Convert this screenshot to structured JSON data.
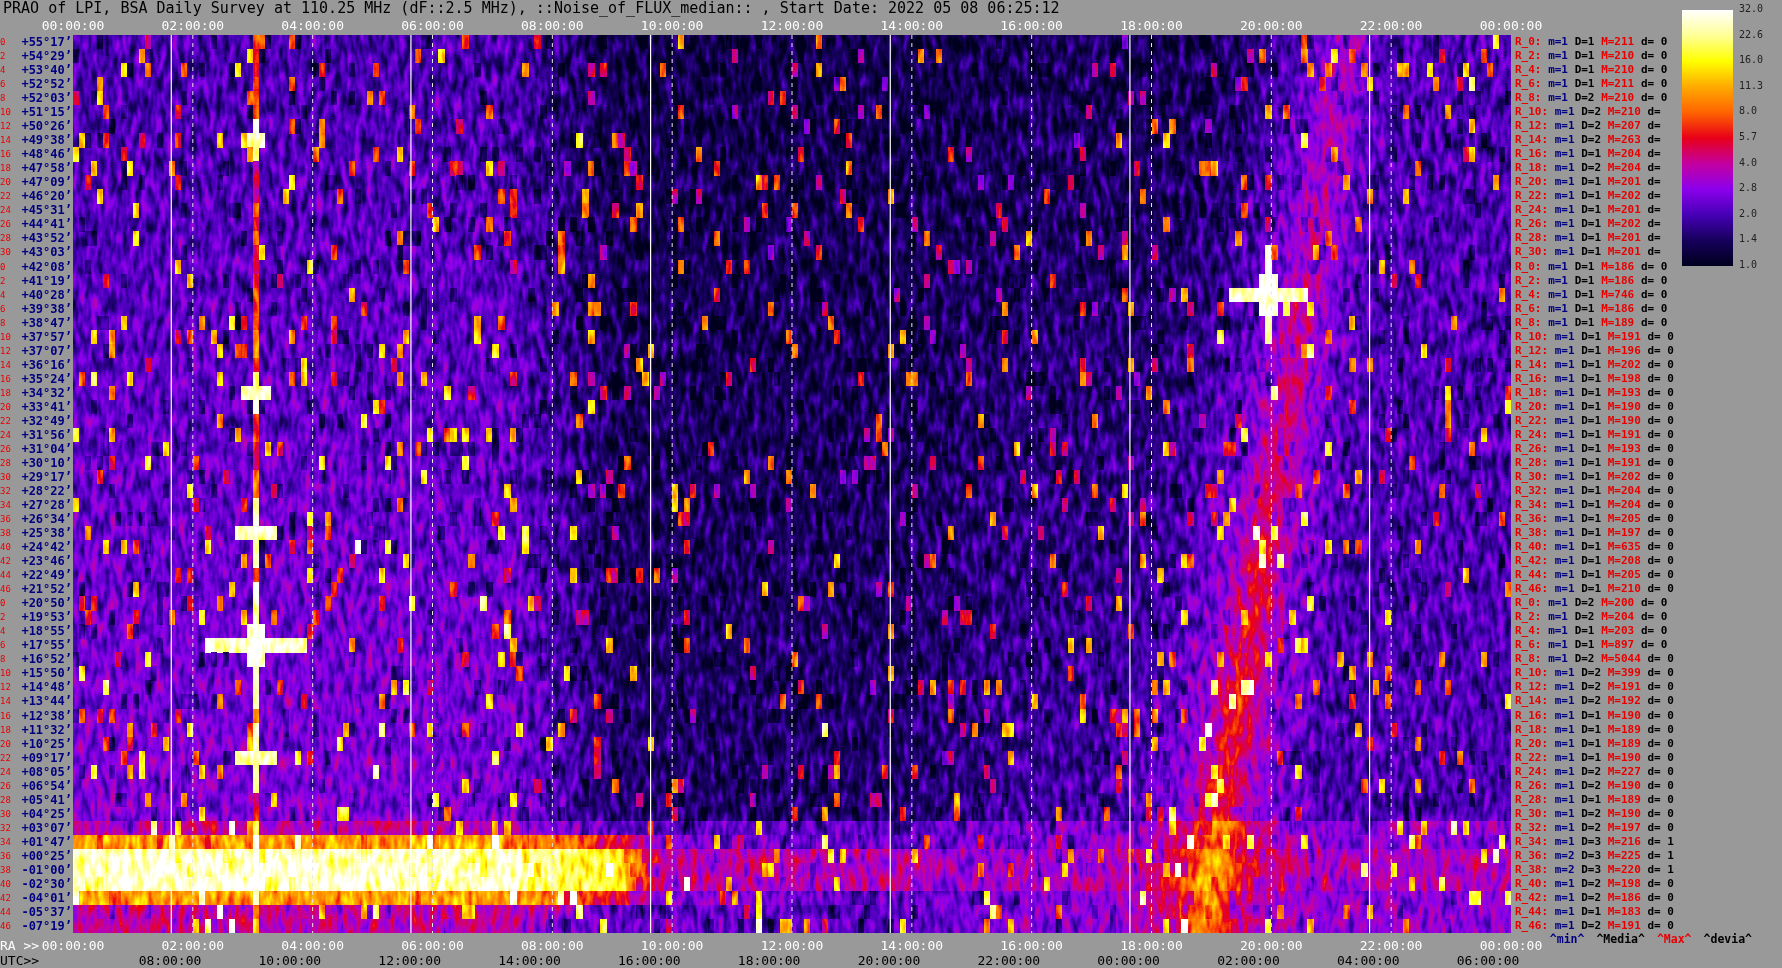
{
  "title": "PRAO of LPI, BSA Daily Survey at 110.25 MHz (dF::2.5 MHz), ::Noise_of_FLUX_median:: , Start Date: 2022 05 08 06:25:12",
  "top_axis": {
    "labels": [
      "00:00:00",
      "02:00:00",
      "04:00:00",
      "06:00:00",
      "08:00:00",
      "10:00:00",
      "12:00:00",
      "14:00:00",
      "16:00:00",
      "18:00:00",
      "20:00:00",
      "22:00:00",
      "00:00:00"
    ]
  },
  "rows": [
    {
      "index": "0",
      "declination": "+55°17’",
      "receiver": "R_0:",
      "min": "m=1",
      "median": "D=1",
      "max": "M=211",
      "deviation": "d= 0"
    },
    {
      "index": "2",
      "declination": "+54°29’",
      "receiver": "R_2:",
      "min": "m=1",
      "median": "D=1",
      "max": "M=210",
      "deviation": "d= 0"
    },
    {
      "index": "4",
      "declination": "+53°40’",
      "receiver": "R_4:",
      "min": "m=1",
      "median": "D=1",
      "max": "M=210",
      "deviation": "d= 0"
    },
    {
      "index": "6",
      "declination": "+52°52’",
      "receiver": "R_6:",
      "min": "m=1",
      "median": "D=1",
      "max": "M=211",
      "deviation": "d= 0"
    },
    {
      "index": "8",
      "declination": "+52°03’",
      "receiver": "R_8:",
      "min": "m=1",
      "median": "D=2",
      "max": "M=210",
      "deviation": "d= 0"
    },
    {
      "index": "10",
      "declination": "+51°15’",
      "receiver": "R_10:",
      "min": "m=1",
      "median": "D=2",
      "max": "M=210",
      "deviation": "d="
    },
    {
      "index": "12",
      "declination": "+50°26’",
      "receiver": "R_12:",
      "min": "m=1",
      "median": "D=2",
      "max": "M=207",
      "deviation": "d="
    },
    {
      "index": "14",
      "declination": "+49°38’",
      "receiver": "R_14:",
      "min": "m=1",
      "median": "D=2",
      "max": "M=263",
      "deviation": "d="
    },
    {
      "index": "16",
      "declination": "+48°46’",
      "receiver": "R_16:",
      "min": "m=1",
      "median": "D=1",
      "max": "M=204",
      "deviation": "d="
    },
    {
      "index": "18",
      "declination": "+47°58’",
      "receiver": "R_18:",
      "min": "m=1",
      "median": "D=2",
      "max": "M=204",
      "deviation": "d="
    },
    {
      "index": "20",
      "declination": "+47°09’",
      "receiver": "R_20:",
      "min": "m=1",
      "median": "D=1",
      "max": "M=201",
      "deviation": "d="
    },
    {
      "index": "22",
      "declination": "+46°20’",
      "receiver": "R_22:",
      "min": "m=1",
      "median": "D=1",
      "max": "M=202",
      "deviation": "d="
    },
    {
      "index": "24",
      "declination": "+45°31’",
      "receiver": "R_24:",
      "min": "m=1",
      "median": "D=1",
      "max": "M=201",
      "deviation": "d="
    },
    {
      "index": "26",
      "declination": "+44°41’",
      "receiver": "R_26:",
      "min": "m=1",
      "median": "D=1",
      "max": "M=202",
      "deviation": "d="
    },
    {
      "index": "28",
      "declination": "+43°52’",
      "receiver": "R_28:",
      "min": "m=1",
      "median": "D=1",
      "max": "M=201",
      "deviation": "d="
    },
    {
      "index": "30",
      "declination": "+43°03’",
      "receiver": "R_30:",
      "min": "m=1",
      "median": "D=1",
      "max": "M=201",
      "deviation": "d="
    },
    {
      "index": "0",
      "declination": "+42°08’",
      "receiver": "R_0:",
      "min": "m=1",
      "median": "D=1",
      "max": "M=186",
      "deviation": "d= 0"
    },
    {
      "index": "2",
      "declination": "+41°19’",
      "receiver": "R_2:",
      "min": "m=1",
      "median": "D=1",
      "max": "M=186",
      "deviation": "d= 0"
    },
    {
      "index": "4",
      "declination": "+40°28’",
      "receiver": "R_4:",
      "min": "m=1",
      "median": "D=1",
      "max": "M=746",
      "deviation": "d= 0"
    },
    {
      "index": "6",
      "declination": "+39°38’",
      "receiver": "R_6:",
      "min": "m=1",
      "median": "D=1",
      "max": "M=186",
      "deviation": "d= 0"
    },
    {
      "index": "8",
      "declination": "+38°47’",
      "receiver": "R_8:",
      "min": "m=1",
      "median": "D=1",
      "max": "M=189",
      "deviation": "d= 0"
    },
    {
      "index": "10",
      "declination": "+37°57’",
      "receiver": "R_10:",
      "min": "m=1",
      "median": "D=1",
      "max": "M=191",
      "deviation": "d= 0"
    },
    {
      "index": "12",
      "declination": "+37°07’",
      "receiver": "R_12:",
      "min": "m=1",
      "median": "D=1",
      "max": "M=196",
      "deviation": "d= 0"
    },
    {
      "index": "14",
      "declination": "+36°16’",
      "receiver": "R_14:",
      "min": "m=1",
      "median": "D=1",
      "max": "M=202",
      "deviation": "d= 0"
    },
    {
      "index": "16",
      "declination": "+35°24’",
      "receiver": "R_16:",
      "min": "m=1",
      "median": "D=1",
      "max": "M=198",
      "deviation": "d= 0"
    },
    {
      "index": "18",
      "declination": "+34°32’",
      "receiver": "R_18:",
      "min": "m=1",
      "median": "D=1",
      "max": "M=193",
      "deviation": "d= 0"
    },
    {
      "index": "20",
      "declination": "+33°41’",
      "receiver": "R_20:",
      "min": "m=1",
      "median": "D=1",
      "max": "M=190",
      "deviation": "d= 0"
    },
    {
      "index": "22",
      "declination": "+32°49’",
      "receiver": "R_22:",
      "min": "m=1",
      "median": "D=1",
      "max": "M=190",
      "deviation": "d= 0"
    },
    {
      "index": "24",
      "declination": "+31°56’",
      "receiver": "R_24:",
      "min": "m=1",
      "median": "D=1",
      "max": "M=191",
      "deviation": "d= 0"
    },
    {
      "index": "26",
      "declination": "+31°04’",
      "receiver": "R_26:",
      "min": "m=1",
      "median": "D=1",
      "max": "M=193",
      "deviation": "d= 0"
    },
    {
      "index": "28",
      "declination": "+30°10’",
      "receiver": "R_28:",
      "min": "m=1",
      "median": "D=1",
      "max": "M=191",
      "deviation": "d= 0"
    },
    {
      "index": "30",
      "declination": "+29°17’",
      "receiver": "R_30:",
      "min": "m=1",
      "median": "D=1",
      "max": "M=202",
      "deviation": "d= 0"
    },
    {
      "index": "32",
      "declination": "+28°22’",
      "receiver": "R_32:",
      "min": "m=1",
      "median": "D=1",
      "max": "M=204",
      "deviation": "d= 0"
    },
    {
      "index": "34",
      "declination": "+27°28’",
      "receiver": "R_34:",
      "min": "m=1",
      "median": "D=1",
      "max": "M=204",
      "deviation": "d= 0"
    },
    {
      "index": "36",
      "declination": "+26°34’",
      "receiver": "R_36:",
      "min": "m=1",
      "median": "D=1",
      "max": "M=205",
      "deviation": "d= 0"
    },
    {
      "index": "38",
      "declination": "+25°38’",
      "receiver": "R_38:",
      "min": "m=1",
      "median": "D=1",
      "max": "M=197",
      "deviation": "d= 0"
    },
    {
      "index": "40",
      "declination": "+24°42’",
      "receiver": "R_40:",
      "min": "m=1",
      "median": "D=1",
      "max": "M=635",
      "deviation": "d= 0"
    },
    {
      "index": "42",
      "declination": "+23°46’",
      "receiver": "R_42:",
      "min": "m=1",
      "median": "D=1",
      "max": "M=208",
      "deviation": "d= 0"
    },
    {
      "index": "44",
      "declination": "+22°49’",
      "receiver": "R_44:",
      "min": "m=1",
      "median": "D=1",
      "max": "M=205",
      "deviation": "d= 0"
    },
    {
      "index": "46",
      "declination": "+21°52’",
      "receiver": "R_46:",
      "min": "m=1",
      "median": "D=1",
      "max": "M=210",
      "deviation": "d= 0"
    },
    {
      "index": "0",
      "declination": "+20°50’",
      "receiver": "R_0:",
      "min": "m=1",
      "median": "D=2",
      "max": "M=200",
      "deviation": "d= 0"
    },
    {
      "index": "2",
      "declination": "+19°53’",
      "receiver": "R_2:",
      "min": "m=1",
      "median": "D=2",
      "max": "M=204",
      "deviation": "d= 0"
    },
    {
      "index": "4",
      "declination": "+18°55’",
      "receiver": "R_4:",
      "min": "m=1",
      "median": "D=1",
      "max": "M=203",
      "deviation": "d= 0"
    },
    {
      "index": "6",
      "declination": "+17°55’",
      "receiver": "R_6:",
      "min": "m=1",
      "median": "D=1",
      "max": "M=897",
      "deviation": "d= 0"
    },
    {
      "index": "8",
      "declination": "+16°52’",
      "receiver": "R_8:",
      "min": "m=1",
      "median": "D=2",
      "max": "M=5044",
      "deviation": "d= 0"
    },
    {
      "index": "10",
      "declination": "+15°50’",
      "receiver": "R_10:",
      "min": "m=1",
      "median": "D=2",
      "max": "M=399",
      "deviation": "d= 0"
    },
    {
      "index": "12",
      "declination": "+14°48’",
      "receiver": "R_12:",
      "min": "m=1",
      "median": "D=2",
      "max": "M=191",
      "deviation": "d= 0"
    },
    {
      "index": "14",
      "declination": "+13°44’",
      "receiver": "R_14:",
      "min": "m=1",
      "median": "D=2",
      "max": "M=192",
      "deviation": "d= 0"
    },
    {
      "index": "16",
      "declination": "+12°38’",
      "receiver": "R_16:",
      "min": "m=1",
      "median": "D=1",
      "max": "M=190",
      "deviation": "d= 0"
    },
    {
      "index": "18",
      "declination": "+11°32’",
      "receiver": "R_18:",
      "min": "m=1",
      "median": "D=1",
      "max": "M=189",
      "deviation": "d= 0"
    },
    {
      "index": "20",
      "declination": "+10°25’",
      "receiver": "R_20:",
      "min": "m=1",
      "median": "D=1",
      "max": "M=189",
      "deviation": "d= 0"
    },
    {
      "index": "22",
      "declination": "+09°17’",
      "receiver": "R_22:",
      "min": "m=1",
      "median": "D=1",
      "max": "M=190",
      "deviation": "d= 0"
    },
    {
      "index": "24",
      "declination": "+08°05’",
      "receiver": "R_24:",
      "min": "m=1",
      "median": "D=2",
      "max": "M=227",
      "deviation": "d= 0"
    },
    {
      "index": "26",
      "declination": "+06°54’",
      "receiver": "R_26:",
      "min": "m=1",
      "median": "D=2",
      "max": "M=190",
      "deviation": "d= 0"
    },
    {
      "index": "28",
      "declination": "+05°41’",
      "receiver": "R_28:",
      "min": "m=1",
      "median": "D=1",
      "max": "M=189",
      "deviation": "d= 0"
    },
    {
      "index": "30",
      "declination": "+04°25’",
      "receiver": "R_30:",
      "min": "m=1",
      "median": "D=2",
      "max": "M=190",
      "deviation": "d= 0"
    },
    {
      "index": "32",
      "declination": "+03°07’",
      "receiver": "R_32:",
      "min": "m=1",
      "median": "D=2",
      "max": "M=197",
      "deviation": "d= 0"
    },
    {
      "index": "34",
      "declination": "+01°47’",
      "receiver": "R_34:",
      "min": "m=1",
      "median": "D=3",
      "max": "M=216",
      "deviation": "d= 1"
    },
    {
      "index": "36",
      "declination": "+00°25’",
      "receiver": "R_36:",
      "min": "m=2",
      "median": "D=3",
      "max": "M=225",
      "deviation": "d= 1"
    },
    {
      "index": "38",
      "declination": "-01°00’",
      "receiver": "R_38:",
      "min": "m=2",
      "median": "D=3",
      "max": "M=220",
      "deviation": "d= 1"
    },
    {
      "index": "40",
      "declination": "-02°30’",
      "receiver": "R_40:",
      "min": "m=1",
      "median": "D=2",
      "max": "M=198",
      "deviation": "d= 0"
    },
    {
      "index": "42",
      "declination": "-04°01’",
      "receiver": "R_42:",
      "min": "m=1",
      "median": "D=2",
      "max": "M=186",
      "deviation": "d= 0"
    },
    {
      "index": "44",
      "declination": "-05°37’",
      "receiver": "R_44:",
      "min": "m=1",
      "median": "D=1",
      "max": "M=183",
      "deviation": "d= 0"
    },
    {
      "index": "46",
      "declination": "-07°19’",
      "receiver": "R_46:",
      "min": "m=1",
      "median": "D=2",
      "max": "M=191",
      "deviation": "d= 0"
    }
  ],
  "color_scale": {
    "ticks": [
      "32.0",
      "22.6",
      "16.0",
      "11.3",
      "8.0",
      "5.7",
      "4.0",
      "2.8",
      "2.0",
      "1.4",
      "1.0"
    ]
  },
  "legend": [
    {
      "label": "^min^",
      "color": "#000080"
    },
    {
      "label": "^Media^",
      "color": "#000000"
    },
    {
      "label": "^Max^",
      "color": "#e80000"
    },
    {
      "label": "^devia^",
      "color": "#000000"
    }
  ],
  "bottom_axis": {
    "ra_title": "RA >>",
    "ra_labels": [
      "00:00:00",
      "02:00:00",
      "04:00:00",
      "06:00:00",
      "08:00:00",
      "10:00:00",
      "12:00:00",
      "14:00:00",
      "16:00:00",
      "18:00:00",
      "20:00:00",
      "22:00:00",
      "00:00:00"
    ],
    "utc_title": "UTC>>",
    "utc_labels": [
      "08:00:00",
      "10:00:00",
      "12:00:00",
      "14:00:00",
      "16:00:00",
      "18:00:00",
      "20:00:00",
      "22:00:00",
      "00:00:00",
      "02:00:00",
      "04:00:00",
      "06:00:00"
    ]
  }
}
